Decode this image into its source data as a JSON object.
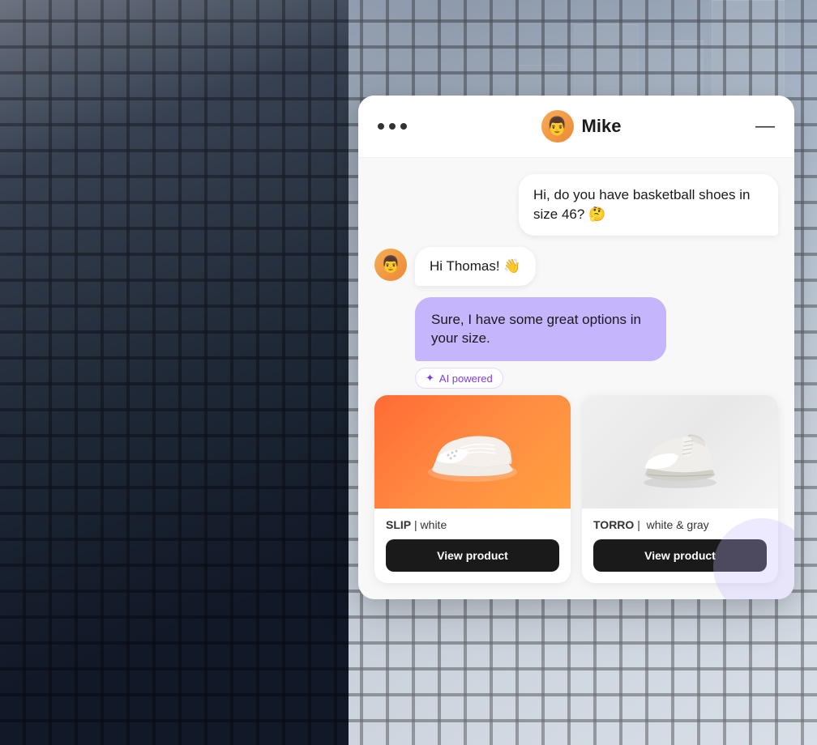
{
  "background": {
    "alt": "Person sitting against fence holding phone"
  },
  "chat": {
    "header": {
      "dots_label": "···",
      "agent_name": "Mike",
      "minimize_label": "—",
      "avatar_emoji": "👨"
    },
    "messages": [
      {
        "id": "msg1",
        "type": "user",
        "text": "Hi, do you have basketball shoes in size 46? 🤔"
      },
      {
        "id": "msg2",
        "type": "agent_greeting",
        "text": "Hi Thomas! 👋"
      },
      {
        "id": "msg3",
        "type": "agent_main",
        "text": "Sure, I have some great options in your size."
      }
    ],
    "ai_badge": {
      "icon": "✦",
      "label": "AI powered"
    },
    "products": [
      {
        "id": "product1",
        "name": "SLIP",
        "color": "white",
        "separator": "|",
        "image_type": "orange",
        "button_label": "View product"
      },
      {
        "id": "product2",
        "name": "TORRO",
        "color": "white & gray",
        "separator": "|",
        "image_type": "white",
        "button_label": "View product"
      }
    ]
  }
}
